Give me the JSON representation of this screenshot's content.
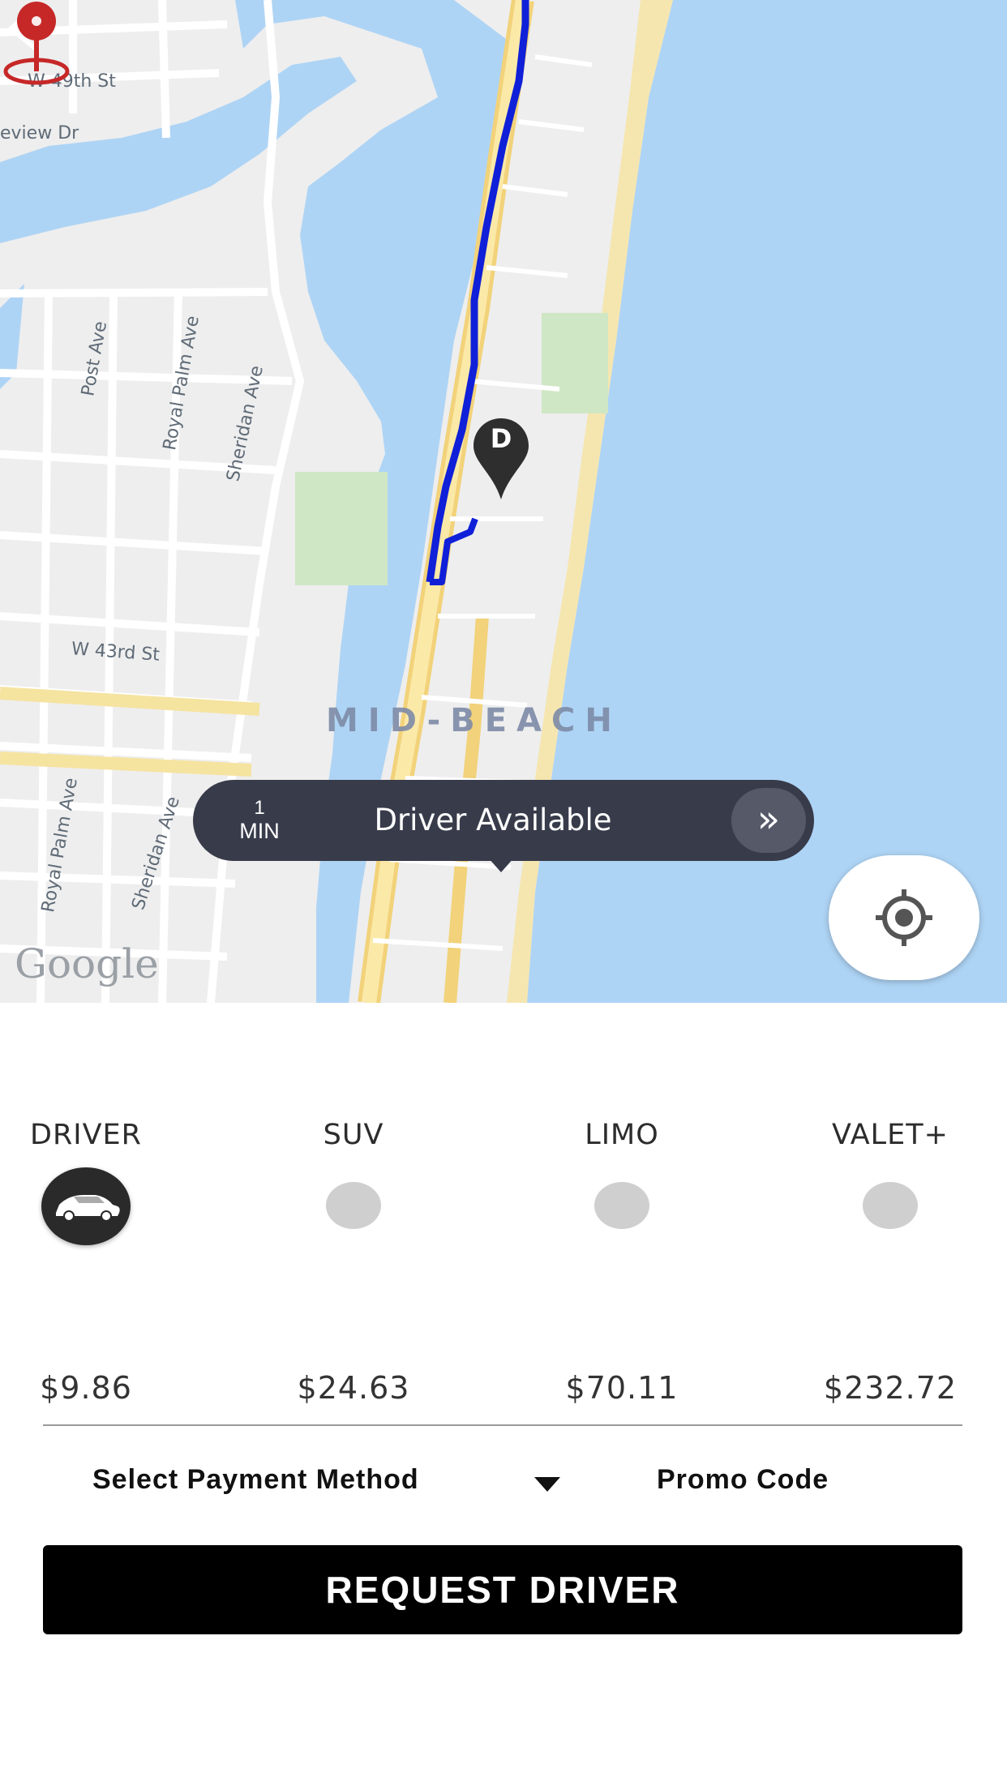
{
  "map": {
    "streets": [
      "W 49th St",
      "eview Dr",
      "Post Ave",
      "Royal Palm Ave",
      "Sheridan Ave",
      "W 43rd St",
      "Royal Palm Ave",
      "Sheridan Ave"
    ],
    "area_label": "MID-BEACH",
    "attribution": "Google",
    "driver_marker_letter": "D"
  },
  "eta": {
    "value": "1",
    "unit": "MIN",
    "status": "Driver Available",
    "action_glyph": "»"
  },
  "ride_types": [
    {
      "label": "DRIVER",
      "price": "$9.86",
      "selected": true,
      "icon": "car-icon"
    },
    {
      "label": "SUV",
      "price": "$24.63",
      "selected": false
    },
    {
      "label": "LIMO",
      "price": "$70.11",
      "selected": false
    },
    {
      "label": "VALET+",
      "price": "$232.72",
      "selected": false
    }
  ],
  "payment": {
    "label": "Select Payment Method",
    "promo": "Promo Code"
  },
  "request_button": "REQUEST DRIVER",
  "colors": {
    "water": "#aed4f5",
    "route": "#1020d8",
    "eta_bubble": "#383b4a",
    "pickup_pin": "#c62828",
    "button": "#000000"
  }
}
